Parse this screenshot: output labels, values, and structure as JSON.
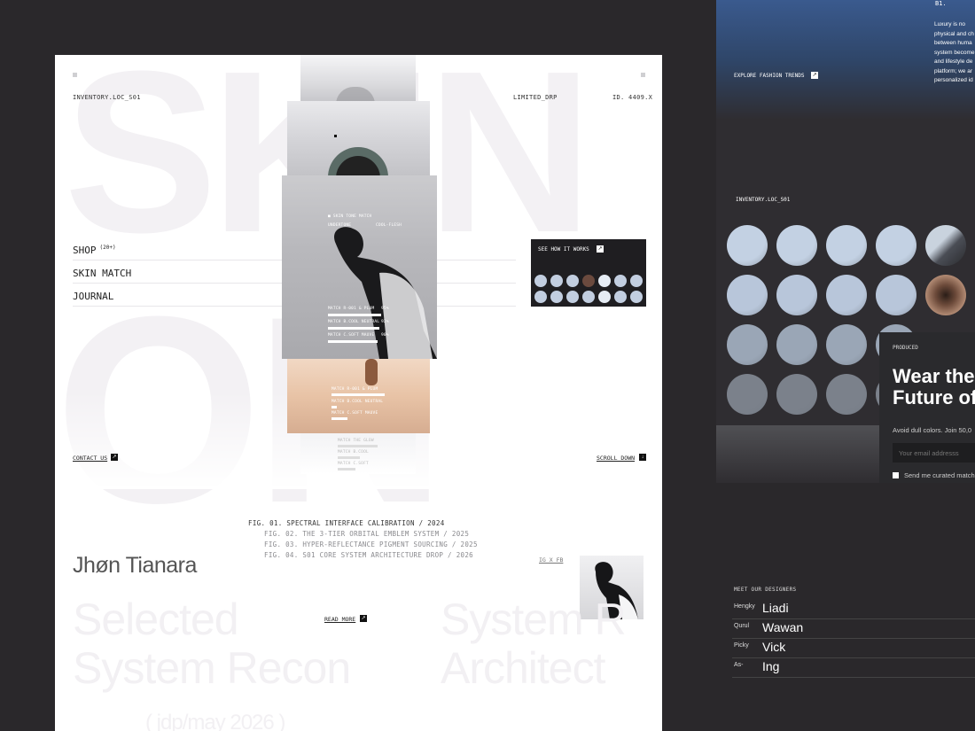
{
  "page": {
    "bg_words": [
      "SKIN",
      "ON"
    ],
    "meta": {
      "left": "INVENTORY.LOC_S01",
      "center": "LIMITED_DRP",
      "right": "ID. 4409.X"
    },
    "nav": [
      {
        "label": "SHOP",
        "sup": "(20+)"
      },
      {
        "label": "SKIN MATCH",
        "sup": ""
      },
      {
        "label": "JOURNAL",
        "sup": ""
      }
    ],
    "center_card": {
      "header": "SKIN TONE MATCH",
      "sub_left": "UNDERTONE",
      "sub_right": "COOL-FLESH",
      "rows": [
        {
          "label": "MATCH R-001 & PLUM",
          "pct": "95%",
          "fill": 0.95
        },
        {
          "label": "MATCH B.COOL NEUTRAL",
          "pct": "92%",
          "fill": 0.92
        },
        {
          "label": "MATCH C.SOFT MAUVE",
          "pct": "90%",
          "fill": 0.9
        }
      ]
    },
    "warm_card_rows": [
      {
        "label": "MATCH R-001 & PLUM",
        "fill": 0.95
      },
      {
        "label": "MATCH B.COOL NEUTRAL",
        "fill": 0.1
      },
      {
        "label": "MATCH C.SOFT MAUVE",
        "fill": 0.3
      }
    ],
    "faint_card_rows": [
      {
        "label": "MATCH THE GLOW",
        "fill": 0.9
      },
      {
        "label": "MATCH B.COOL",
        "fill": 0.5
      },
      {
        "label": "MATCH C.SOFT",
        "fill": 0.4
      }
    ],
    "how_it_works": "SEE HOW IT WORKS",
    "contact": "CONTACT US",
    "scroll": "SCROLL DOWN",
    "figs": [
      "FIG. 01.    SPECTRAL INTERFACE CALIBRATION / 2024",
      "FIG. 02.    THE 3-TIER ORBITAL EMBLEM SYSTEM / 2025",
      "FIG. 03.    HYPER-REFLECTANCE PIGMENT SOURCING / 2025",
      "FIG. 04.    S01 CORE SYSTEM ARCHITECTURE DROP / 2026"
    ],
    "author": "Jhøn Tianara",
    "social": "IG X FB",
    "read_more": "READ MORE",
    "ghost_left": [
      "Selected",
      "System Recon"
    ],
    "ghost_right": [
      "System R",
      "Architect"
    ],
    "ghost_date": "( jdp/may 2026 )"
  },
  "right_panel": {
    "top_label": "B1.",
    "paragraph": [
      "Luxury is no",
      "physical and ch",
      "between huma",
      "system become",
      "and lifestyle de",
      "platform; we ar",
      "personalized id"
    ],
    "explore": "EXPLORE FASHION TRENDS",
    "inventory": "INVENTORY.LOC_S01",
    "card": {
      "tag": "PRODUCED",
      "headline": [
        "Wear the",
        "Future of"
      ],
      "subtext": "Avoid dull colors. Join 50,0",
      "email_placeholder": "Your email addresss",
      "checkbox_label": "Send me curated match"
    }
  },
  "designers": {
    "title": "MEET OUR DESIGNERS",
    "list": [
      {
        "first": "Hengky",
        "last": "Liadi"
      },
      {
        "first": "Qurul",
        "last": "Wawan"
      },
      {
        "first": "Picky",
        "last": "Vick"
      },
      {
        "first": "As-",
        "last": "Ing"
      }
    ]
  }
}
